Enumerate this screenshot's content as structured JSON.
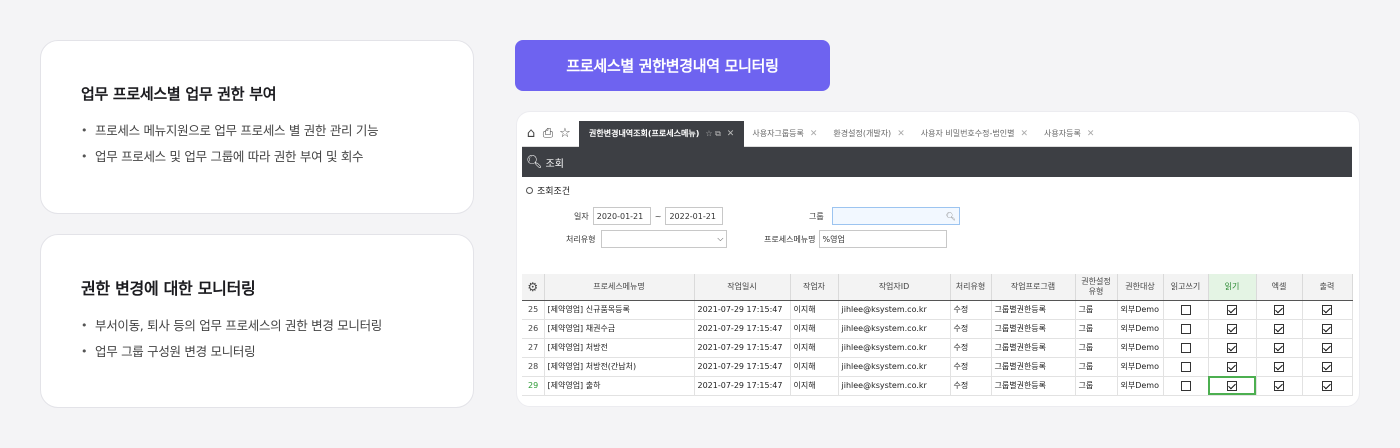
{
  "card1": {
    "title": "업무 프로세스별 업무 권한 부여",
    "items": [
      "프로세스 메뉴지원으로 업무 프로세스 별 권한 관리 기능",
      "업무 프로세스 및 업무 그룹에 따라 권한 부여 및 회수"
    ]
  },
  "card2": {
    "title": "권한 변경에 대한 모니터링",
    "items": [
      "부서이동, 퇴사 등의 업무 프로세스의 권한 변경 모니터링",
      "업무 그룹 구성원 변경 모니터링"
    ]
  },
  "pill": {
    "label": "프로세스별 권한변경내역 모니터링"
  },
  "app": {
    "tabs": [
      {
        "label": "권한변경내역조회(프로세스메뉴)",
        "active": true
      },
      {
        "label": "사용자그룹등록"
      },
      {
        "label": "환경설정(개발자)"
      },
      {
        "label": "사용자 비밀번호수정-법인별"
      },
      {
        "label": "사용자등록"
      }
    ],
    "search_label": "조회",
    "cond_title": "조회조건",
    "date_label": "일자",
    "date_from": "2020-01-21",
    "date_sep": "~",
    "date_to": "2022-01-21",
    "group_label": "그룹",
    "type_label": "처리유형",
    "menu_label": "프로세스메뉴명",
    "menu_value": "%영업",
    "columns": [
      "프로세스메뉴명",
      "작업일시",
      "작업자",
      "작업자ID",
      "처리유형",
      "작업프로그램",
      "권한설정\n유형",
      "권한대상",
      "읽고쓰기",
      "읽기",
      "엑셀",
      "출력"
    ],
    "rows": [
      {
        "no": "25",
        "menu": "[제약영업] 신규품목등록",
        "time": "2021-07-29 17:15:47",
        "user": "이지해",
        "id": "jihlee@ksystem.co.kr",
        "type": "수정",
        "program": "그룹별권한등록",
        "auth": "그룹",
        "target": "외부Demo",
        "rw": false,
        "read": true,
        "excel": true,
        "print": true
      },
      {
        "no": "26",
        "menu": "[제약영업] 채권수금",
        "time": "2021-07-29 17:15:47",
        "user": "이지해",
        "id": "jihlee@ksystem.co.kr",
        "type": "수정",
        "program": "그룹별권한등록",
        "auth": "그룹",
        "target": "외부Demo",
        "rw": false,
        "read": true,
        "excel": true,
        "print": true
      },
      {
        "no": "27",
        "menu": "[제약영업] 처방전",
        "time": "2021-07-29 17:15:47",
        "user": "이지해",
        "id": "jihlee@ksystem.co.kr",
        "type": "수정",
        "program": "그룹별권한등록",
        "auth": "그룹",
        "target": "외부Demo",
        "rw": false,
        "read": true,
        "excel": true,
        "print": true
      },
      {
        "no": "28",
        "menu": "[제약영업] 처방전(간납처)",
        "time": "2021-07-29 17:15:47",
        "user": "이지해",
        "id": "jihlee@ksystem.co.kr",
        "type": "수정",
        "program": "그룹별권한등록",
        "auth": "그룹",
        "target": "외부Demo",
        "rw": false,
        "read": true,
        "excel": true,
        "print": true
      },
      {
        "no": "29",
        "menu": "[제약영업] 출하",
        "time": "2021-07-29 17:15:47",
        "user": "이지해",
        "id": "jihlee@ksystem.co.kr",
        "type": "수정",
        "program": "그룹별권한등록",
        "auth": "그룹",
        "target": "외부Demo",
        "rw": false,
        "read": true,
        "excel": true,
        "print": true,
        "selected": true
      }
    ]
  }
}
